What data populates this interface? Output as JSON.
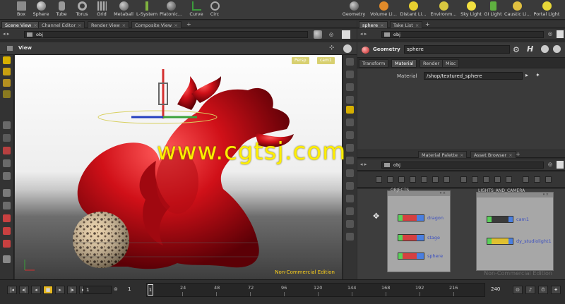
{
  "shelf": {
    "left_tools": [
      "Box",
      "Sphere",
      "Tube",
      "Torus",
      "Grid",
      "Metaball",
      "L-System",
      "Platonic...",
      "Curve",
      "Circ"
    ],
    "right_tools": [
      "Geometry",
      "Volume Li...",
      "Distant Li...",
      "Environm...",
      "Sky Light",
      "GI Light",
      "Caustic Li...",
      "Portal Light"
    ]
  },
  "left_tabs": [
    "Scene View",
    "Channel Editor",
    "Render View",
    "Composite View"
  ],
  "right_tabs": [
    "sphere",
    "Take List"
  ],
  "lower_right_tabs": [
    "Material Palette",
    "Asset Browser"
  ],
  "paths": {
    "viewport": "obj",
    "params": "obj",
    "network": "obj"
  },
  "viewport": {
    "title": "View",
    "cam_button_1": "Persp",
    "cam_button_2": "cam1",
    "watermark": "www.cgtsj.com",
    "edition": "Non-Commercial Edition"
  },
  "params": {
    "type_label": "Geometry",
    "node_name": "sphere",
    "tabs": [
      "Transform",
      "Material",
      "Render",
      "Misc"
    ],
    "active_tab": "Material",
    "material_label": "Material",
    "material_value": "/shop/textured_sphere"
  },
  "network": {
    "box1_title": "OBJECTS",
    "box2_title": "LIGHTS_AND_CAMERA",
    "box1_nodes": [
      "dragon",
      "stage",
      "sphere"
    ],
    "box2_nodes": [
      "cam1",
      "dy_studiolight1"
    ],
    "footer": "Non-Commercial Edition"
  },
  "timeline": {
    "start_frame": "1",
    "start_frame_2": "1",
    "ticks": [
      "24",
      "48",
      "72",
      "96",
      "120",
      "144",
      "168",
      "192",
      "216"
    ],
    "current": "1",
    "end_frame": "240"
  },
  "colors": {
    "dragon": "#d01018",
    "accent_yellow": "#ffd21a",
    "node_label": "#3b4fc0"
  }
}
